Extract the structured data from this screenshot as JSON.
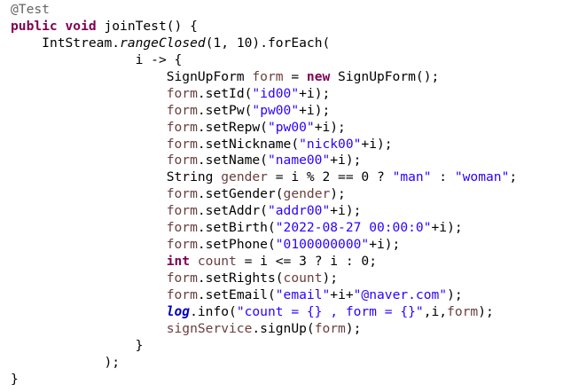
{
  "editor": {
    "lines": [
      {
        "indent": 0,
        "tokens": [
          {
            "t": "@Test",
            "s": "ann"
          }
        ]
      },
      {
        "indent": 0,
        "tokens": [
          {
            "t": "public",
            "s": "kw"
          },
          {
            "t": " ",
            "s": "plain"
          },
          {
            "t": "void",
            "s": "kw"
          },
          {
            "t": " joinTest() {",
            "s": "plain"
          }
        ]
      },
      {
        "indent": 1,
        "tokens": [
          {
            "t": "IntStream.",
            "s": "plain"
          },
          {
            "t": "rangeClosed",
            "s": "ital"
          },
          {
            "t": "(1, 10).forEach(",
            "s": "plain"
          }
        ]
      },
      {
        "indent": 4,
        "tokens": [
          {
            "t": "i -> {",
            "s": "plain"
          }
        ]
      },
      {
        "indent": 5,
        "tokens": [
          {
            "t": "SignUpForm ",
            "s": "plain"
          },
          {
            "t": "form",
            "s": "var"
          },
          {
            "t": " = ",
            "s": "plain"
          },
          {
            "t": "new",
            "s": "kw"
          },
          {
            "t": " SignUpForm();",
            "s": "plain"
          }
        ]
      },
      {
        "indent": 5,
        "tokens": [
          {
            "t": "form",
            "s": "var"
          },
          {
            "t": ".setId(",
            "s": "plain"
          },
          {
            "t": "\"id00\"",
            "s": "str"
          },
          {
            "t": "+i);",
            "s": "plain"
          }
        ]
      },
      {
        "indent": 5,
        "tokens": [
          {
            "t": "form",
            "s": "var"
          },
          {
            "t": ".setPw(",
            "s": "plain"
          },
          {
            "t": "\"pw00\"",
            "s": "str"
          },
          {
            "t": "+i);",
            "s": "plain"
          }
        ]
      },
      {
        "indent": 5,
        "tokens": [
          {
            "t": "form",
            "s": "var"
          },
          {
            "t": ".setRepw(",
            "s": "plain"
          },
          {
            "t": "\"pw00\"",
            "s": "str"
          },
          {
            "t": "+i);",
            "s": "plain"
          }
        ]
      },
      {
        "indent": 5,
        "tokens": [
          {
            "t": "form",
            "s": "var"
          },
          {
            "t": ".setNickname(",
            "s": "plain"
          },
          {
            "t": "\"nick00\"",
            "s": "str"
          },
          {
            "t": "+i);",
            "s": "plain"
          }
        ]
      },
      {
        "indent": 5,
        "tokens": [
          {
            "t": "form",
            "s": "var"
          },
          {
            "t": ".setName(",
            "s": "plain"
          },
          {
            "t": "\"name00\"",
            "s": "str"
          },
          {
            "t": "+i);",
            "s": "plain"
          }
        ]
      },
      {
        "indent": 5,
        "tokens": [
          {
            "t": "String ",
            "s": "plain"
          },
          {
            "t": "gender",
            "s": "var"
          },
          {
            "t": " = i % 2 == 0 ? ",
            "s": "plain"
          },
          {
            "t": "\"man\"",
            "s": "str"
          },
          {
            "t": " : ",
            "s": "plain"
          },
          {
            "t": "\"woman\"",
            "s": "str"
          },
          {
            "t": ";",
            "s": "plain"
          }
        ]
      },
      {
        "indent": 5,
        "tokens": [
          {
            "t": "form",
            "s": "var"
          },
          {
            "t": ".setGender(",
            "s": "plain"
          },
          {
            "t": "gender",
            "s": "var"
          },
          {
            "t": ");",
            "s": "plain"
          }
        ]
      },
      {
        "indent": 5,
        "tokens": [
          {
            "t": "form",
            "s": "var"
          },
          {
            "t": ".setAddr(",
            "s": "plain"
          },
          {
            "t": "\"addr00\"",
            "s": "str"
          },
          {
            "t": "+i);",
            "s": "plain"
          }
        ]
      },
      {
        "indent": 5,
        "tokens": [
          {
            "t": "form",
            "s": "var"
          },
          {
            "t": ".setBirth(",
            "s": "plain"
          },
          {
            "t": "\"2022-08-27 00:00:0\"",
            "s": "str"
          },
          {
            "t": "+i);",
            "s": "plain"
          }
        ]
      },
      {
        "indent": 5,
        "tokens": [
          {
            "t": "form",
            "s": "var"
          },
          {
            "t": ".setPhone(",
            "s": "plain"
          },
          {
            "t": "\"0100000000\"",
            "s": "str"
          },
          {
            "t": "+i);",
            "s": "plain"
          }
        ]
      },
      {
        "indent": 5,
        "tokens": [
          {
            "t": "int",
            "s": "kw"
          },
          {
            "t": " ",
            "s": "plain"
          },
          {
            "t": "count",
            "s": "var"
          },
          {
            "t": " = i <= 3 ? i : 0;",
            "s": "plain"
          }
        ]
      },
      {
        "indent": 5,
        "tokens": [
          {
            "t": "form",
            "s": "var"
          },
          {
            "t": ".setRights(",
            "s": "plain"
          },
          {
            "t": "count",
            "s": "var"
          },
          {
            "t": ");",
            "s": "plain"
          }
        ]
      },
      {
        "indent": 5,
        "tokens": [
          {
            "t": "form",
            "s": "var"
          },
          {
            "t": ".setEmail(",
            "s": "plain"
          },
          {
            "t": "\"email\"",
            "s": "str"
          },
          {
            "t": "+i+",
            "s": "plain"
          },
          {
            "t": "\"@naver.com\"",
            "s": "str"
          },
          {
            "t": ");",
            "s": "plain"
          }
        ]
      },
      {
        "indent": 5,
        "tokens": [
          {
            "t": "log",
            "s": "stat"
          },
          {
            "t": ".info(",
            "s": "plain"
          },
          {
            "t": "\"count = {} , form = {}\"",
            "s": "str"
          },
          {
            "t": ",i,",
            "s": "plain"
          },
          {
            "t": "form",
            "s": "var"
          },
          {
            "t": ");",
            "s": "plain"
          }
        ]
      },
      {
        "indent": 5,
        "tokens": [
          {
            "t": "signService",
            "s": "var"
          },
          {
            "t": ".signUp(",
            "s": "plain"
          },
          {
            "t": "form",
            "s": "var"
          },
          {
            "t": ");",
            "s": "plain"
          }
        ]
      },
      {
        "indent": 4,
        "tokens": [
          {
            "t": "}",
            "s": "plain"
          }
        ]
      },
      {
        "indent": 3,
        "tokens": [
          {
            "t": ");",
            "s": "plain"
          }
        ]
      },
      {
        "indent": 0,
        "tokens": [
          {
            "t": "}",
            "s": "plain"
          }
        ]
      }
    ],
    "colors": {
      "annotation": "#646464",
      "keyword": "#7f0055",
      "string": "#2a00ff",
      "local_variable": "#6a3e3e",
      "static_field": "#0000c0",
      "plain": "#000000",
      "background": "#ffffff"
    }
  }
}
